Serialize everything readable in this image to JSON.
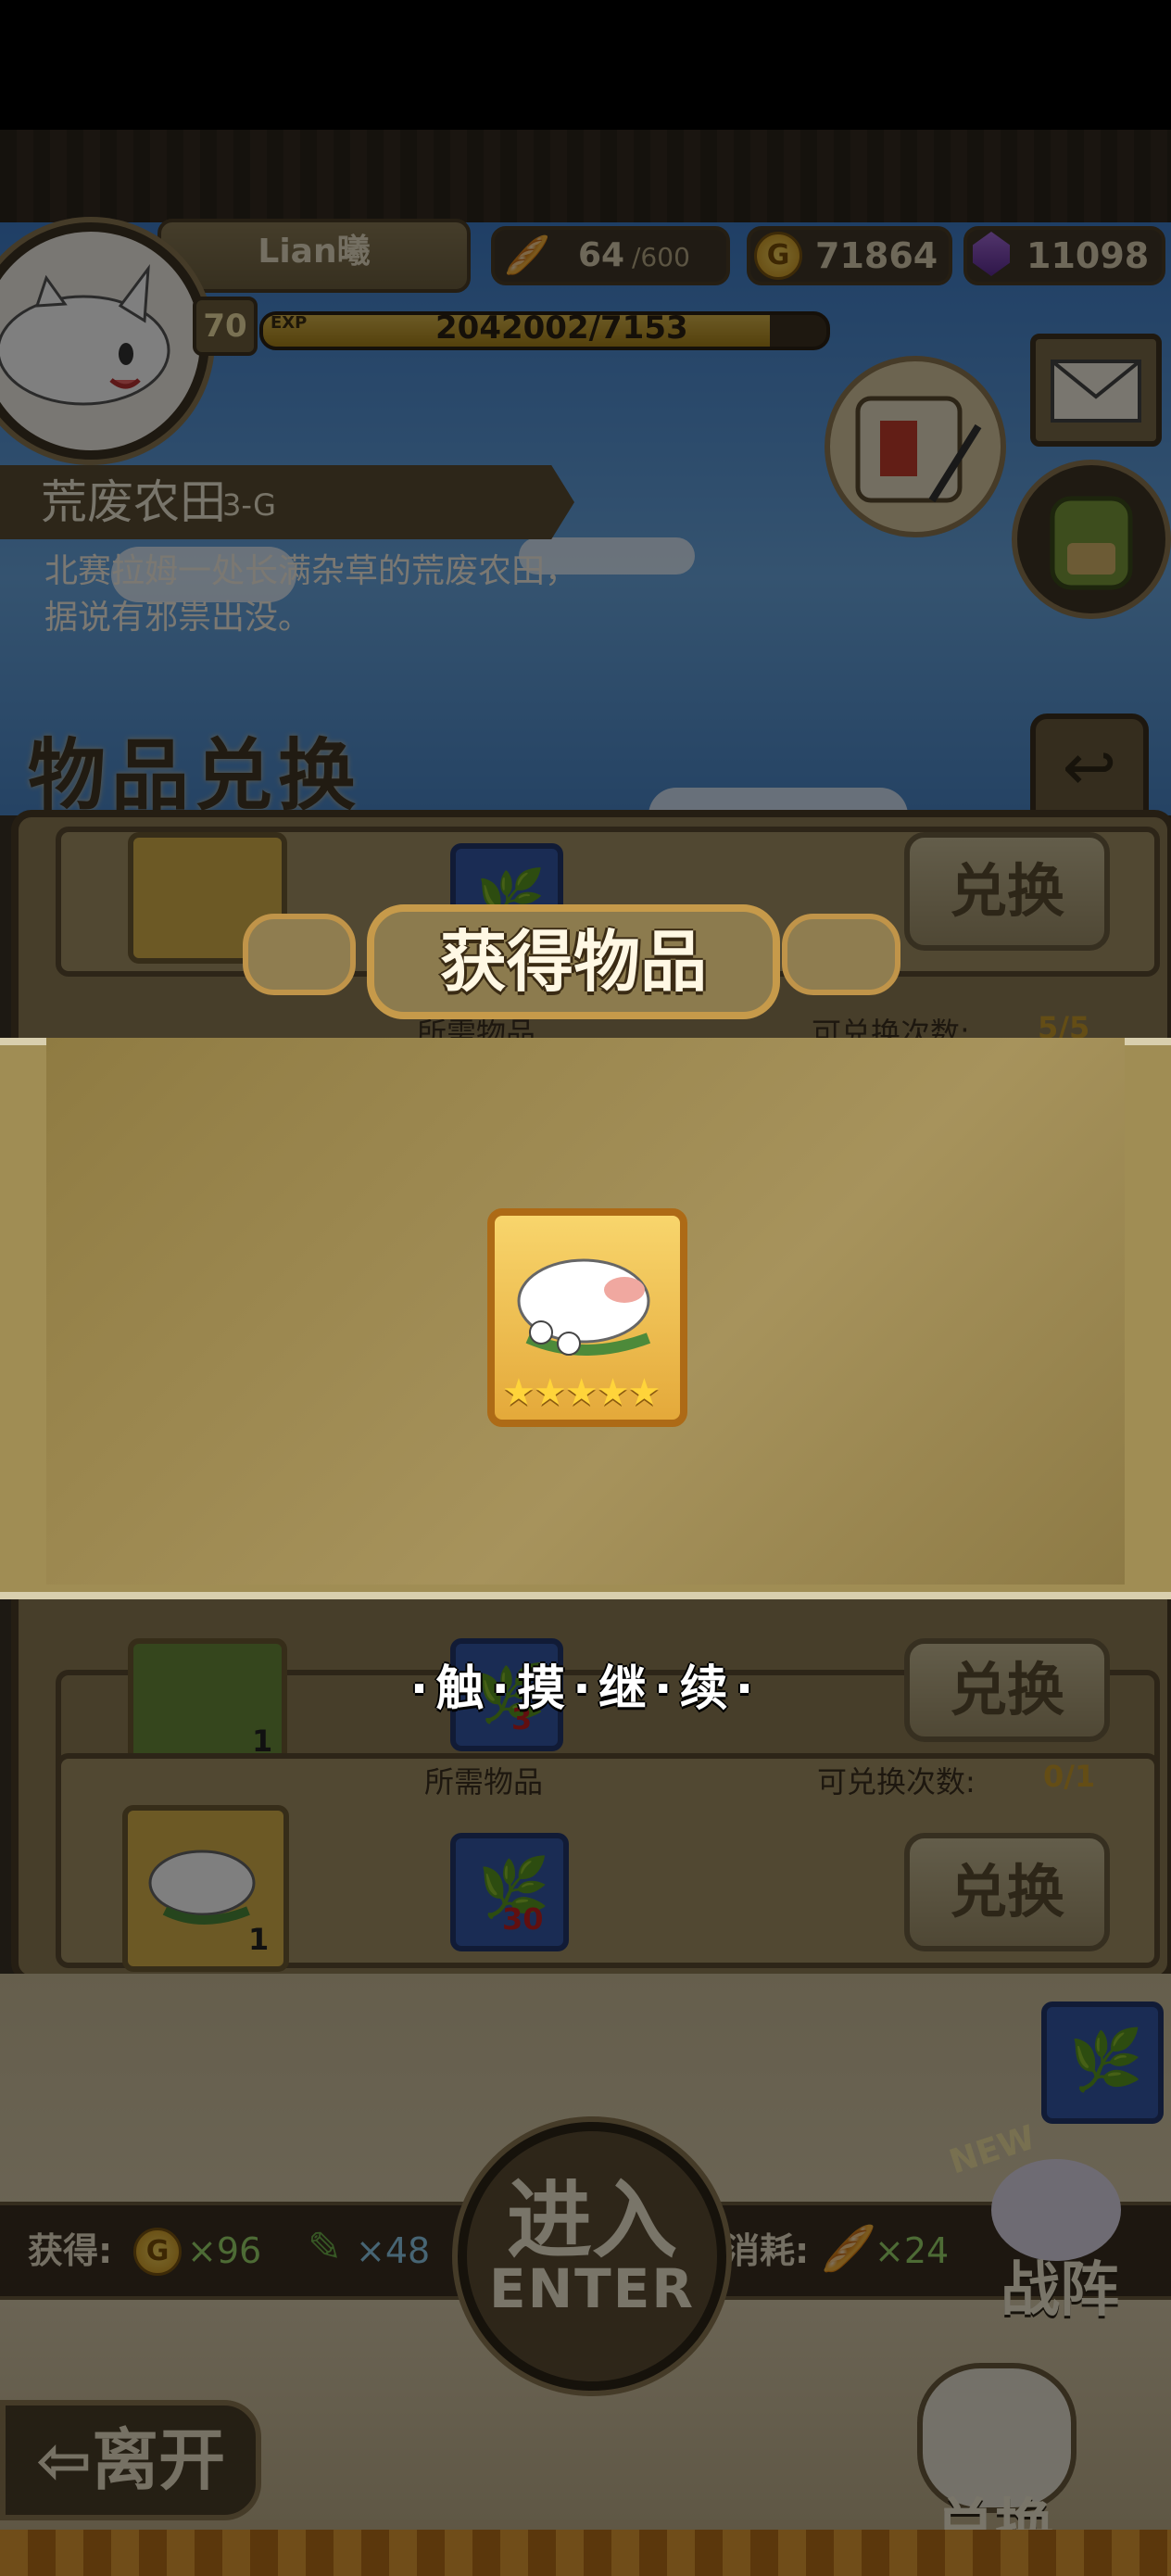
{
  "player": {
    "name": "Lian曦",
    "level": "70",
    "exp_label": "EXP",
    "exp_value": "2042002/7153",
    "exp_fraction": 0.9
  },
  "resources": {
    "stamina_current": "64",
    "stamina_max": "/600",
    "gold": "71864",
    "gems": "11098"
  },
  "location": {
    "name": "荒废农田",
    "code": "3-G",
    "description": "北赛拉姆一处长满杂草的荒废农田，据说有邪祟出没。"
  },
  "exchange_panel": {
    "title": "物品兑换",
    "back_label": "↩",
    "rows": [
      {
        "required_label": "所需物品",
        "count_label": "可兑换次数:",
        "count": "5/5",
        "reward_qty": "",
        "cost_qty": "",
        "button": "兑换"
      },
      {
        "required_label": "所需物品",
        "count_label": "可兑换次数:",
        "count": "",
        "reward_qty": "1",
        "cost_qty": "3",
        "button": "兑换"
      },
      {
        "required_label": "所需物品",
        "count_label": "可兑换次数:",
        "count": "0/1",
        "reward_qty": "1",
        "cost_qty": "30",
        "button": "兑换"
      }
    ]
  },
  "modal": {
    "title": "获得物品",
    "stars": 5,
    "tap_continue": "·触·摸·继·续·"
  },
  "footer": {
    "gain_label": "获得:",
    "gain_gold": "×96",
    "gain_feather": "×48",
    "cost_label": "消耗:",
    "cost_stamina": "×24",
    "enter_zh": "进入",
    "enter_en": "ENTER",
    "formation_new": "NEW",
    "formation_label": "战阵",
    "leave_label": "离开",
    "exchange_label": "兑换",
    "coin_symbol": "G"
  },
  "colors": {
    "gold": "#d9b24a",
    "blue_slot": "#3458a8",
    "green_value": "#9ad66a"
  }
}
